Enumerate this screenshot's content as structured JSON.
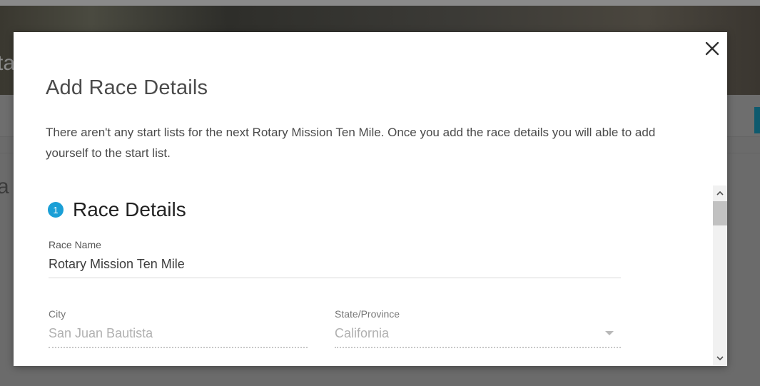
{
  "background": {
    "hero_partial_text": "ta",
    "left_partial_text": "a"
  },
  "modal": {
    "title": "Add Race Details",
    "description": "There aren't any start lists for the next Rotary Mission Ten Mile. Once you add the race details you will able to add yourself to the start list.",
    "close_icon": "close-icon",
    "section": {
      "step_number": "1",
      "title": "Race Details"
    },
    "fields": {
      "race_name": {
        "label": "Race Name",
        "value": "Rotary Mission Ten Mile"
      },
      "city": {
        "label": "City",
        "value": "San Juan Bautista"
      },
      "state": {
        "label": "State/Province",
        "value": "California"
      }
    }
  },
  "colors": {
    "accent": "#1a9fd6",
    "title_text": "#4a4a4a",
    "disabled_text": "#b0b0b0"
  }
}
